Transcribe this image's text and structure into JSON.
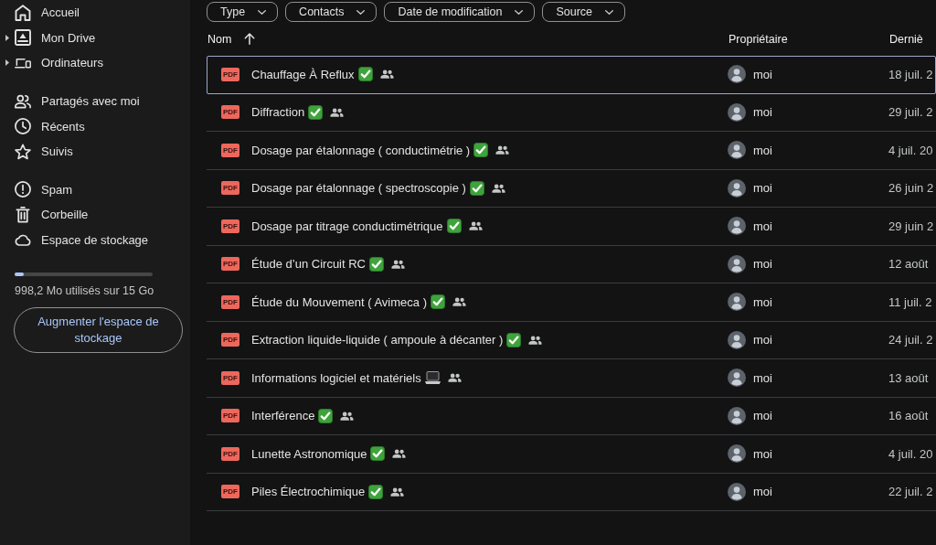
{
  "sidebar": {
    "sections": [
      {
        "items": [
          {
            "label": "Accueil",
            "selected": false
          },
          {
            "label": "Mon Drive",
            "selected": false,
            "expanded": false
          },
          {
            "label": "Ordinateurs",
            "selected": false,
            "expanded": false
          }
        ]
      },
      {
        "items": [
          {
            "label": "Partagés avec moi",
            "selected": false
          },
          {
            "label": "Récents",
            "selected": false
          },
          {
            "label": "Suivis",
            "selected": false
          }
        ]
      },
      {
        "items": [
          {
            "label": "Spam",
            "selected": false
          },
          {
            "label": "Corbeille",
            "selected": false
          },
          {
            "label": "Espace de stockage",
            "selected": false
          }
        ]
      }
    ],
    "storage": {
      "level": 0.066,
      "usage": "998,2 Mo utilisés sur 15 Go",
      "button": "Augmenter l'espace de stockage"
    }
  },
  "filters": [
    {
      "label": "Type"
    },
    {
      "label": "Contacts"
    },
    {
      "label": "Date de modification"
    },
    {
      "label": "Source"
    }
  ],
  "table": {
    "columns": [
      {
        "label": "Nom",
        "sorted": true
      },
      {
        "label": "Propriétaire",
        "sorted": false
      },
      {
        "label": "Derniè",
        "sorted": false
      }
    ],
    "rows": [
      {
        "type": "PDF",
        "name": "Chauffage À Reflux",
        "kind": "check",
        "shared": true,
        "owner": "moi",
        "modified": "18 juil. 2",
        "selected": true
      },
      {
        "type": "PDF",
        "name": "Diffraction",
        "kind": "check",
        "shared": true,
        "owner": "moi",
        "modified": "29 juil. 2",
        "selected": false
      },
      {
        "type": "PDF",
        "name": "Dosage par étalonnage ( conductimétrie )",
        "kind": "check",
        "shared": true,
        "owner": "moi",
        "modified": "4 juil. 20",
        "selected": false
      },
      {
        "type": "PDF",
        "name": "Dosage par étalonnage ( spectroscopie )",
        "kind": "check",
        "shared": true,
        "owner": "moi",
        "modified": "26 juin 2",
        "selected": false
      },
      {
        "type": "PDF",
        "name": "Dosage par titrage conductimétrique",
        "kind": "check",
        "shared": true,
        "owner": "moi",
        "modified": "29 juin 2",
        "selected": false
      },
      {
        "type": "PDF",
        "name": "Étude d’un Circuit RC",
        "kind": "check",
        "shared": true,
        "owner": "moi",
        "modified": "12 août",
        "selected": false
      },
      {
        "type": "PDF",
        "name": "Étude du Mouvement ( Avimeca )",
        "kind": "check",
        "shared": true,
        "owner": "moi",
        "modified": "11 juil. 2",
        "selected": false
      },
      {
        "type": "PDF",
        "name": "Extraction liquide-liquide ( ampoule à décanter )",
        "kind": "check",
        "shared": true,
        "owner": "moi",
        "modified": "24 juil. 2",
        "selected": false
      },
      {
        "type": "PDF",
        "name": "Informations logiciel et matériels",
        "kind": "laptop",
        "shared": true,
        "owner": "moi",
        "modified": "13 août",
        "selected": false
      },
      {
        "type": "PDF",
        "name": "Interférence",
        "kind": "check",
        "shared": true,
        "owner": "moi",
        "modified": "16 août",
        "selected": false
      },
      {
        "type": "PDF",
        "name": "Lunette Astronomique",
        "kind": "check",
        "shared": true,
        "owner": "moi",
        "modified": "4 juil. 20",
        "selected": false
      },
      {
        "type": "PDF",
        "name": "Piles Électrochimique",
        "kind": "check",
        "shared": true,
        "owner": "moi",
        "modified": "22 juil. 2",
        "selected": false
      }
    ]
  }
}
